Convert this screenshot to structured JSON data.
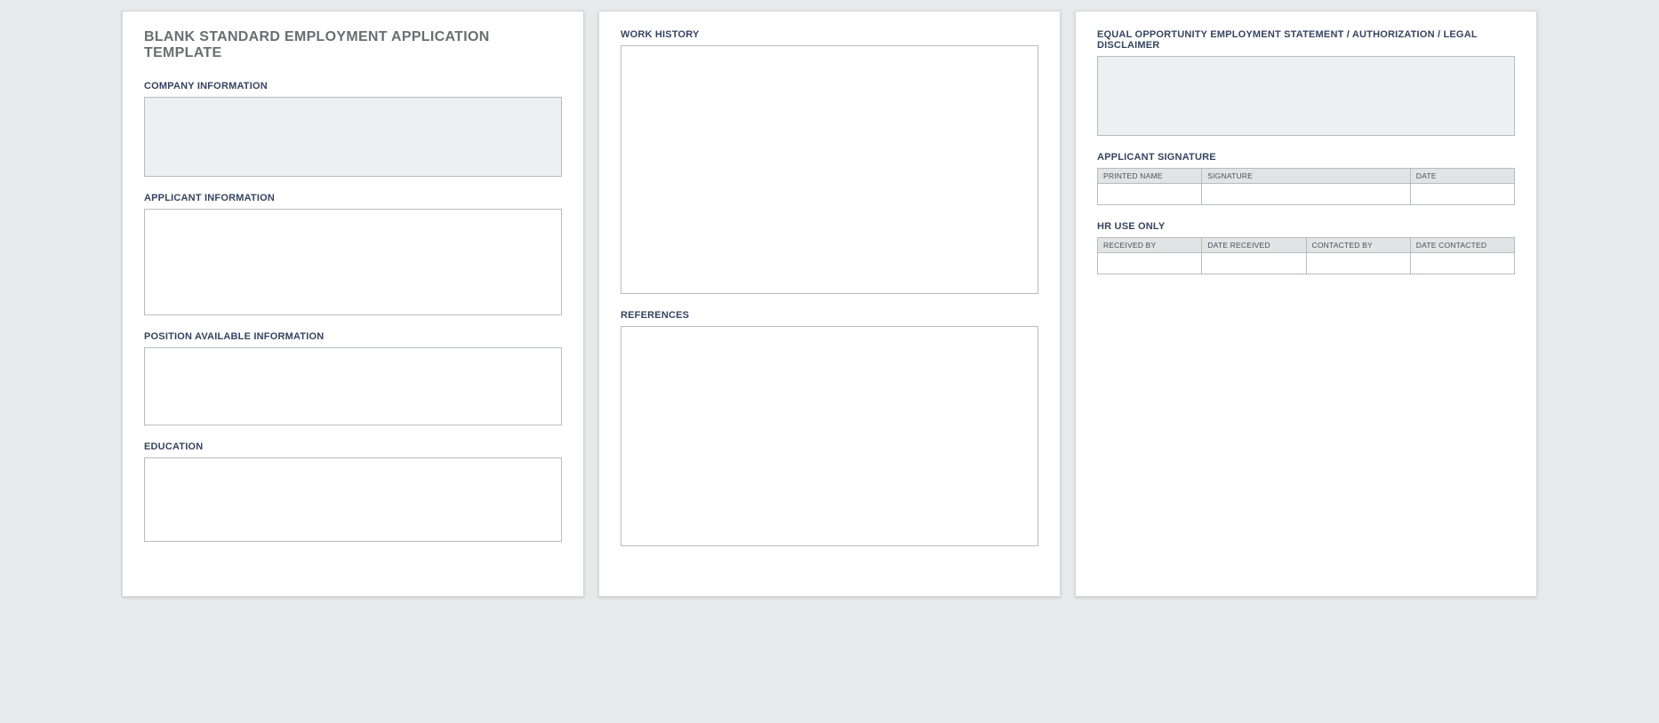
{
  "title": "BLANK STANDARD EMPLOYMENT APPLICATION TEMPLATE",
  "page1": {
    "company_info": "COMPANY INFORMATION",
    "applicant_info": "APPLICANT INFORMATION",
    "position_info": "POSITION AVAILABLE INFORMATION",
    "education": "EDUCATION"
  },
  "page2": {
    "work_history": "WORK HISTORY",
    "references": "REFERENCES"
  },
  "page3": {
    "eoe": "EQUAL OPPORTUNITY EMPLOYMENT STATEMENT / AUTHORIZATION / LEGAL DISCLAIMER",
    "signature": "APPLICANT SIGNATURE",
    "sig_cols": {
      "printed": "PRINTED NAME",
      "signature": "SIGNATURE",
      "date": "DATE"
    },
    "hr": "HR USE ONLY",
    "hr_cols": {
      "received_by": "RECEIVED BY",
      "date_received": "DATE RECEIVED",
      "contacted_by": "CONTACTED BY",
      "date_contacted": "DATE CONTACTED"
    }
  }
}
